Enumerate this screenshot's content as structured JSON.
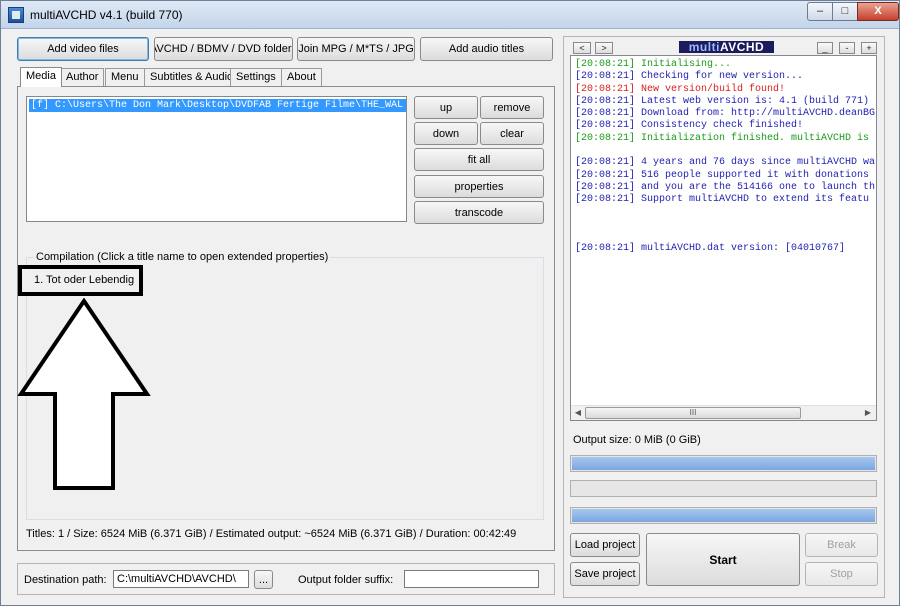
{
  "window": {
    "title": "multiAVCHD v4.1 (build 770)",
    "controls": {
      "minimize": "–",
      "maximize": "□",
      "close": "X"
    }
  },
  "toolbar": {
    "add_video": "Add video files",
    "avchd_folders": "AVCHD / BDMV / DVD folders",
    "join_mpg": "Join MPG / M*TS / JPG",
    "add_audio": "Add audio titles"
  },
  "tabs": [
    "Media",
    "Author",
    "Menu",
    "Subtitles & Audio",
    "Settings",
    "About"
  ],
  "media": {
    "file_item": "[f] C:\\Users\\The Don Mark\\Desktop\\DVDFAB Fertige Filme\\THE_WAL",
    "buttons": {
      "up": "up",
      "remove": "remove",
      "down": "down",
      "clear": "clear",
      "fit_all": "fit all",
      "properties": "properties",
      "transcode": "transcode"
    },
    "compilation_title": "Compilation (Click a title name to open extended properties)",
    "titles": [
      "1. Tot oder Lebendig"
    ],
    "status": "Titles: 1 / Size: 6524 MiB (6.371 GiB) / Estimated output: ~6524 MiB (6.371 GiB) / Duration: 00:42:49"
  },
  "destination": {
    "label": "Destination path:",
    "value": "C:\\multiAVCHD\\AVCHD\\",
    "browse": "...",
    "suffix_label": "Output folder suffix:",
    "suffix_value": ""
  },
  "right": {
    "nav": {
      "prev": "< ",
      "next": " >"
    },
    "logo_multi": "multi",
    "logo_avchd": "AVCHD",
    "small_controls": [
      "_",
      "-",
      "+"
    ],
    "log": [
      {
        "time": "[20:08:21]",
        "text": "Initialising...",
        "color": "#1a9a1a"
      },
      {
        "time": "[20:08:21]",
        "text": "Checking for new version...",
        "color": "#1f1fb0"
      },
      {
        "time": "[20:08:21]",
        "text": "New version/build found!",
        "color": "#d81e1e"
      },
      {
        "time": "[20:08:21]",
        "text": "Latest web version is: 4.1 (build 771)",
        "color": "#1f1fb0"
      },
      {
        "time": "[20:08:21]",
        "text": "Download from: http://multiAVCHD.deanBG",
        "color": "#1f1fb0"
      },
      {
        "time": "[20:08:21]",
        "text": "Consistency check finished!",
        "color": "#1f1fb0"
      },
      {
        "time": "[20:08:21]",
        "text": "Initialization finished. multiAVCHD is",
        "color": "#1a9a1a"
      },
      {
        "time": "",
        "text": "",
        "color": "#1f1fb0"
      },
      {
        "time": "[20:08:21]",
        "text": "4 years and 76 days since multiAVCHD wa",
        "color": "#1f1fb0"
      },
      {
        "time": "[20:08:21]",
        "text": "516 people supported it with donations",
        "color": "#1f1fb0"
      },
      {
        "time": "[20:08:21]",
        "text": "and you are the 514166 one to launch th",
        "color": "#1f1fb0"
      },
      {
        "time": "[20:08:21]",
        "text": "Support multiAVCHD to extend its featu",
        "color": "#1f1fb0"
      },
      {
        "time": "",
        "text": "",
        "color": "#1f1fb0"
      },
      {
        "time": "",
        "text": "",
        "color": "#1f1fb0"
      },
      {
        "time": "",
        "text": "",
        "color": "#1f1fb0"
      },
      {
        "time": "[20:08:21]",
        "text": "multiAVCHD.dat version: [04010767]",
        "color": "#1f1fb0"
      }
    ],
    "scroll_thumb_glyph": "III",
    "output_size": "Output size: 0 MiB (0 GiB)",
    "progress": [
      1.0,
      0.0,
      1.0
    ],
    "load_project": "Load project",
    "save_project": "Save project",
    "start": "Start",
    "break": "Break",
    "stop": "Stop"
  }
}
